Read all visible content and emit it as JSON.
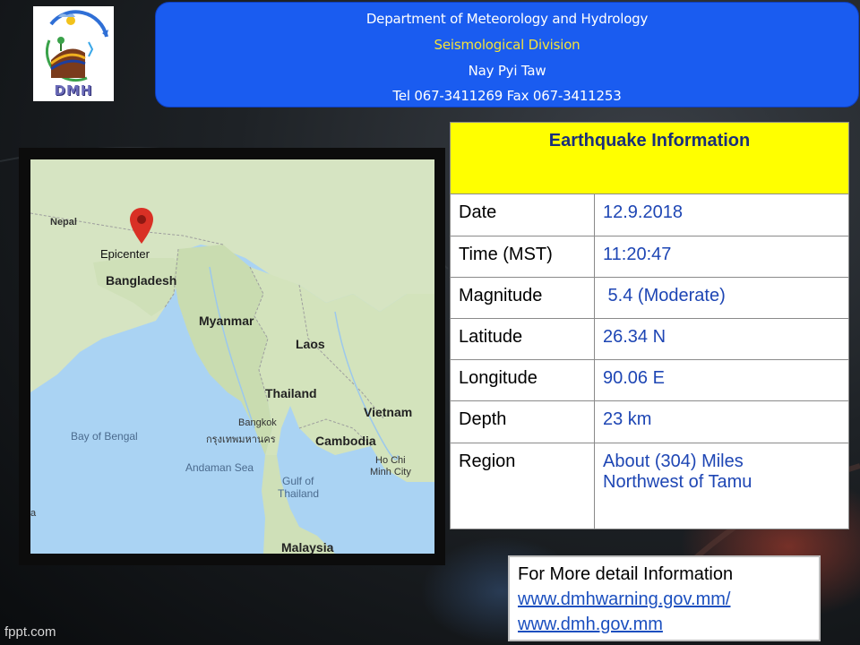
{
  "header": {
    "line1": "Department of Meteorology and Hydrology",
    "line2": "Seismological Division",
    "line3": "Nay Pyi Taw",
    "line4": "Tel 067-3411269 Fax 067-3411253"
  },
  "logo": {
    "text": "DMH"
  },
  "map": {
    "epicenter_label": "Epicenter",
    "labels": {
      "nepal": "Nepal",
      "bangladesh": "Bangladesh",
      "myanmar": "Myanmar",
      "laos": "Laos",
      "thailand": "Thailand",
      "vietnam": "Vietnam",
      "cambodia": "Cambodia",
      "malaysia": "Malaysia",
      "bangkok": "Bangkok",
      "bangkok_thai": "กรุงเทพมหานคร",
      "bay_of_bengal": "Bay of Bengal",
      "andaman_sea": "Andaman Sea",
      "gulf_line1": "Gulf of",
      "gulf_line2": "Thailand",
      "hcm_line1": "Ho Chi",
      "hcm_line2": "Minh City",
      "edge_a": "a"
    }
  },
  "earthquake": {
    "title": "Earthquake Information",
    "rows": [
      {
        "label": "Date",
        "value": "12.9.2018"
      },
      {
        "label": "Time (MST)",
        "value": "11:20:47"
      },
      {
        "label": "Magnitude",
        "value": " 5.4 (Moderate)"
      },
      {
        "label": "Latitude",
        "value": "26.34 N"
      },
      {
        "label": "Longitude",
        "value": "90.06 E"
      },
      {
        "label": "Depth",
        "value": "23 km"
      },
      {
        "label": "Region",
        "value_line1": "About (304) Miles",
        "value_line2": "Northwest of Tamu"
      }
    ]
  },
  "more_info": {
    "heading": "For More detail Information",
    "link1": "www.dmhwarning.gov.mm/",
    "link2": "www.dmh.gov.mm"
  },
  "footer": {
    "text": "fppt.com"
  },
  "colors": {
    "header_bg": "#1a5cf0",
    "title_bg": "#ffff00",
    "value_text": "#1e46b4",
    "marker": "#d93025"
  },
  "icons": {
    "epicenter_marker": "map-pin-icon"
  }
}
